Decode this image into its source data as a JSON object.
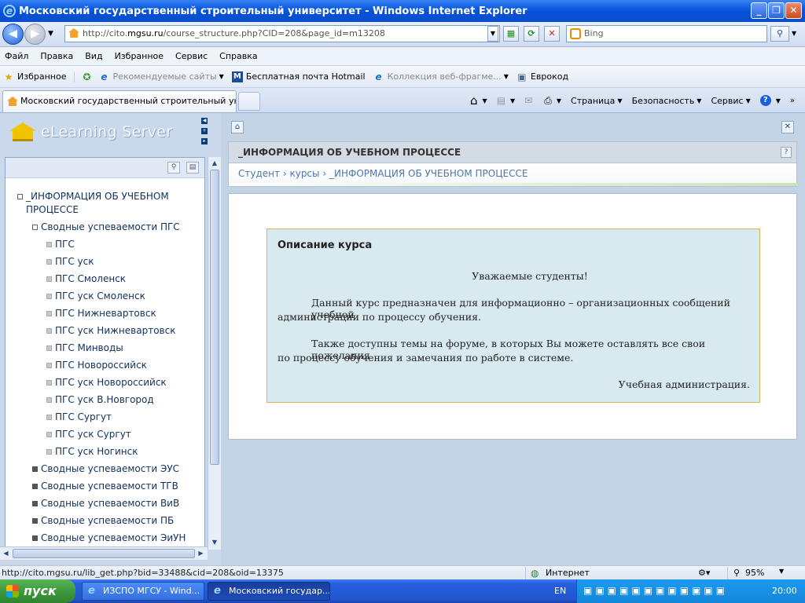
{
  "window": {
    "title": "Московский государственный строительный университет - Windows Internet Explorer",
    "min": "_",
    "max": "❐",
    "close": "✕"
  },
  "address": {
    "prefix": "http://cito.",
    "domain": "mgsu.ru",
    "path": "/course_structure.php?CID=208&page_id=m13208",
    "search_placeholder": "Bing"
  },
  "menu": [
    "Файл",
    "Правка",
    "Вид",
    "Избранное",
    "Сервис",
    "Справка"
  ],
  "favbar": {
    "favorites": "Избранное",
    "recommended": "Рекомендуемые сайты",
    "hotmail": "Бесплатная почта Hotmail",
    "webslice": "Коллекция веб-фрагме...",
    "evrokod": "Еврокод"
  },
  "tab": {
    "title": "Московский государственный строительный унив..."
  },
  "commandbar": {
    "page": "Страница",
    "safety": "Безопасность",
    "tools": "Сервис"
  },
  "app": {
    "logo": "eLearning Server"
  },
  "tree": {
    "root": [
      "_ИНФОРМАЦИЯ ОБ УЧЕБНОМ",
      "ПРОЦЕССЕ"
    ],
    "group_open": "Сводные успеваемости ПГС",
    "leaves": [
      "ПГС",
      "ПГС уск",
      "ПГС Смоленск",
      "ПГС уск Смоленск",
      "ПГС Нижневартовск",
      "ПГС уск Нижневартовск",
      "ПГС Минводы",
      "ПГС Новороссийск",
      "ПГС уск Новороссийск",
      "ПГС уск В.Новгород",
      "ПГС Сургут",
      "ПГС уск Сургут",
      "ПГС уск Ногинск"
    ],
    "groups_closed": [
      "Сводные успеваемости ЭУС",
      "Сводные успеваемости ТГВ",
      "Сводные успеваемости ВиВ",
      "Сводные успеваемости ПБ",
      "Сводные успеваемости ЭиУН"
    ]
  },
  "info": {
    "header": "_ИНФОРМАЦИЯ ОБ УЧЕБНОМ ПРОЦЕССЕ",
    "help": "?",
    "crumb_student": "Студент",
    "crumb_courses": "курсы",
    "crumb_current": "_ИНФОРМАЦИЯ ОБ УЧЕБНОМ ПРОЦЕССЕ",
    "sep": "›"
  },
  "course": {
    "heading": "Описание курса",
    "greeting": "Уважаемые студенты!",
    "p1_line1": "Данный курс предназначен для информационно – организационных сообщений учебной",
    "p1_line2": "администрации по процессу обучения.",
    "p2_line1": "Также доступны темы на форуме, в которых Вы можете оставлять  все свои пожелания",
    "p2_line2": "по процессу обучения и замечания по работе в системе.",
    "signature": "Учебная администрация."
  },
  "status": {
    "url": "http://cito.mgsu.ru/lib_get.php?bid=33488&cid=208&oid=13375",
    "zone": "Интернет",
    "zoom": "95%"
  },
  "taskbar": {
    "start": "пуск",
    "task1": "ИЗСПО МГСУ - Wind...",
    "task2": "Московский государ...",
    "lang": "EN",
    "clock": "20:00"
  },
  "colors": {
    "titlebar": "#0a5ae0",
    "taskbar": "#245edb",
    "start": "#3c9a3c"
  }
}
